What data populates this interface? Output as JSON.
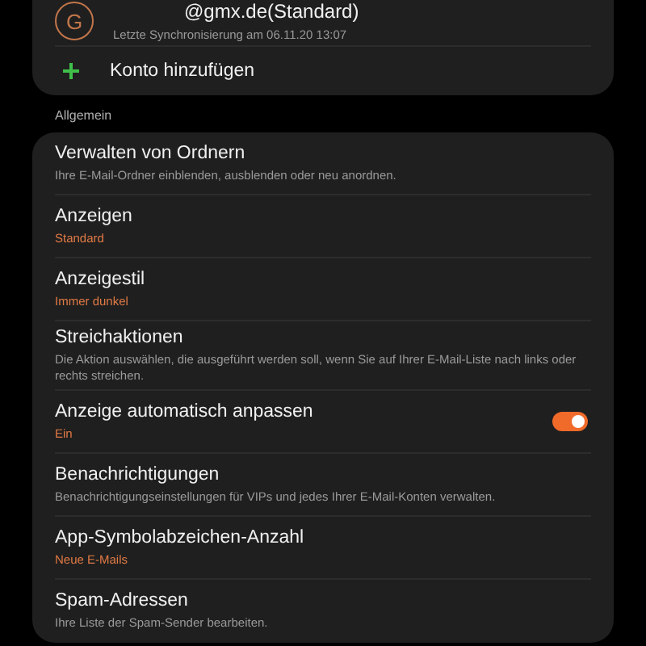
{
  "account": {
    "avatar_letter": "G",
    "email": "@gmx.de(Standard)",
    "sync": "Letzte Synchronisierung am 06.11.20  13:07"
  },
  "add_account": {
    "label": "Konto hinzufügen"
  },
  "section": "Allgemein",
  "settings": [
    {
      "kind": "description",
      "title": "Verwalten von Ordnern",
      "subtitle": "Ihre E-Mail-Ordner einblenden, ausblenden oder neu anordnen."
    },
    {
      "kind": "value",
      "title": "Anzeigen",
      "subtitle": "Standard"
    },
    {
      "kind": "value",
      "title": "Anzeigestil",
      "subtitle": "Immer dunkel"
    },
    {
      "kind": "description",
      "title": "Streichaktionen",
      "subtitle": "Die Aktion auswählen, die ausgeführt werden soll, wenn Sie auf Ihrer E-Mail-Liste nach links oder rechts streichen."
    },
    {
      "kind": "toggle",
      "title": "Anzeige automatisch anpassen",
      "subtitle": "Ein",
      "on": true
    },
    {
      "kind": "description",
      "title": "Benachrichtigungen",
      "subtitle": "Benachrichtigungseinstellungen für VIPs und jedes Ihrer E-Mail-Konten verwalten."
    },
    {
      "kind": "value",
      "title": "App-Symbolabzeichen-Anzahl",
      "subtitle": "Neue E-Mails"
    },
    {
      "kind": "description",
      "title": "Spam-Adressen",
      "subtitle": "Ihre Liste der Spam-Sender bearbeiten."
    }
  ]
}
